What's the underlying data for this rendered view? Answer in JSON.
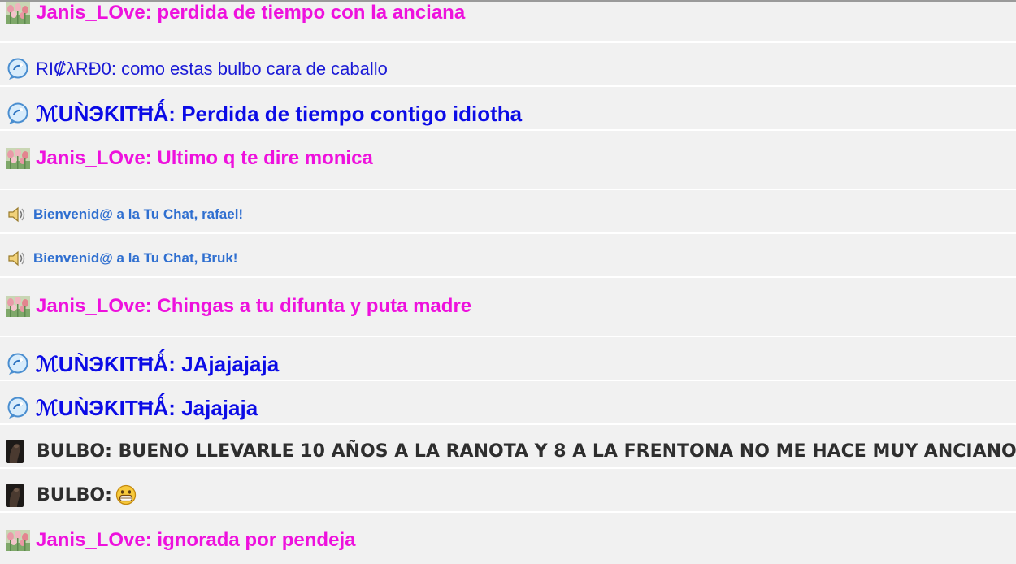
{
  "messages": [
    {
      "user": "Janis_LOve",
      "sep": ": ",
      "text": "perdida de tiempo con la anciana"
    },
    {
      "user": "RI₡λRĐ0",
      "sep": ": ",
      "text": "como estas bulbo cara de caballo"
    },
    {
      "user": "ℳUǸЭƘITĦǺ",
      "sep": ": ",
      "text": "Perdida de tiempo contigo idiotha"
    },
    {
      "user": "Janis_LOve",
      "sep": ": ",
      "text": "Ultimo q te dire monica"
    },
    {
      "text": "Bienvenid@ a la Tu Chat, rafael!"
    },
    {
      "text": "Bienvenid@ a la Tu Chat, Bruk!"
    },
    {
      "user": "Janis_LOve",
      "sep": ": ",
      "text": "Chingas a tu difunta y puta madre"
    },
    {
      "user": "ℳUǸЭƘITĦǺ",
      "sep": ": ",
      "text": "JAjajajaja"
    },
    {
      "user": "ℳUǸЭƘITĦǺ",
      "sep": ": ",
      "text": "Jajajaja"
    },
    {
      "user": "BULBO",
      "sep": ": ",
      "text": "BUENO LLEVARLE 10 AÑOS A LA RANOTA Y 8 A LA FRENTONA NO ME HACE MUY ANCIANO"
    },
    {
      "user": "BULBO",
      "sep": ": ",
      "text": "",
      "emoji": "grinning-face-icon"
    },
    {
      "user": "Janis_LOve",
      "sep": ": ",
      "text": "ignorada por pendeja"
    }
  ],
  "icons": {
    "janis": "tulips-avatar-icon",
    "ricardo": "blue-bubble-icon",
    "munekitha": "blue-bubble-icon",
    "system": "speaker-icon",
    "bulbo": "horse-avatar-icon"
  },
  "colors": {
    "background": "#f1f1f1",
    "janis": "#ee11dd",
    "ricardo": "#1a1ad6",
    "munekitha": "#0b0be6",
    "system": "#2f6fd0",
    "bulbo": "#2e2e2e"
  }
}
